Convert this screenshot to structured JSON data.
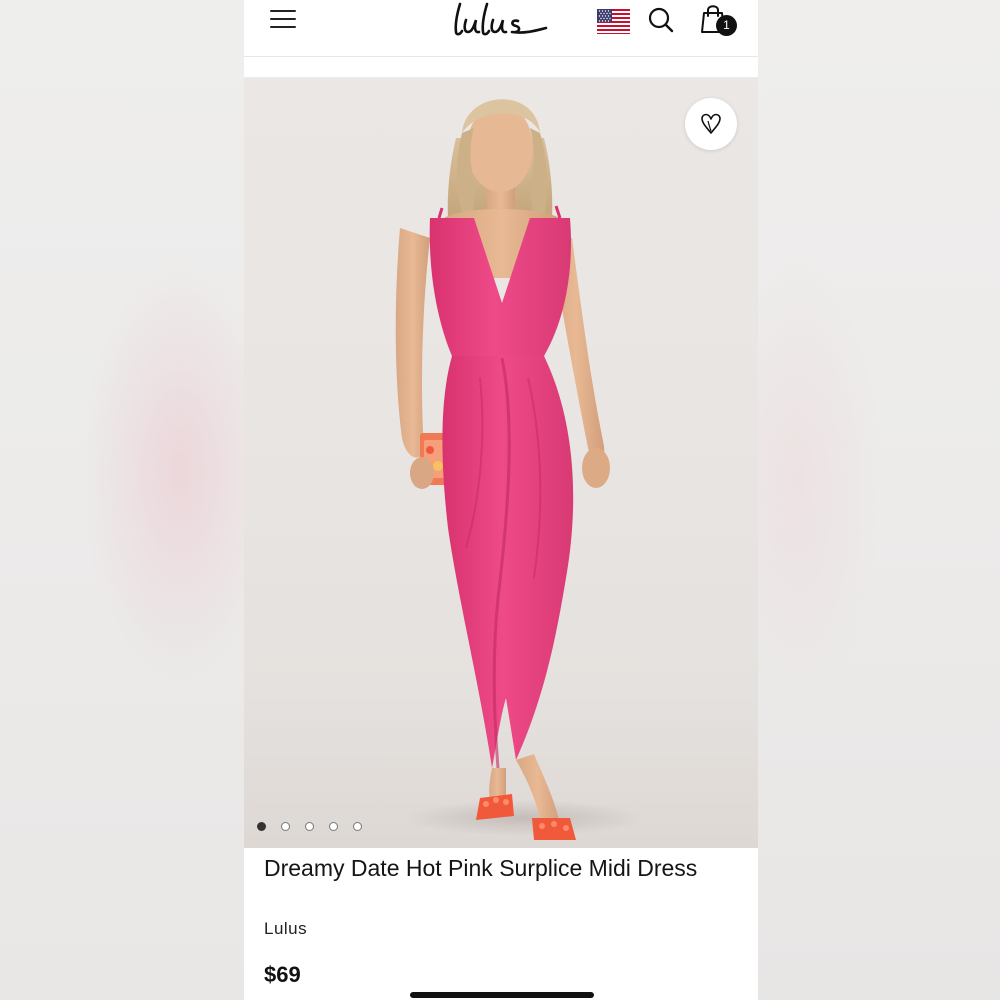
{
  "header": {
    "logo_text": "Lulus",
    "cart_count": "1",
    "icons": {
      "menu": "hamburger-menu-icon",
      "flag": "us-flag-icon",
      "search": "search-icon",
      "cart": "shopping-bag-icon"
    }
  },
  "gallery": {
    "image_count": 5,
    "active_index": 0,
    "wishlist_icon": "heart-icon"
  },
  "product": {
    "title": "Dreamy Date Hot Pink Surplice Midi Dress",
    "brand": "Lulus",
    "price": "$69"
  },
  "colors": {
    "dress": "#e84382",
    "accent": "#111111"
  }
}
